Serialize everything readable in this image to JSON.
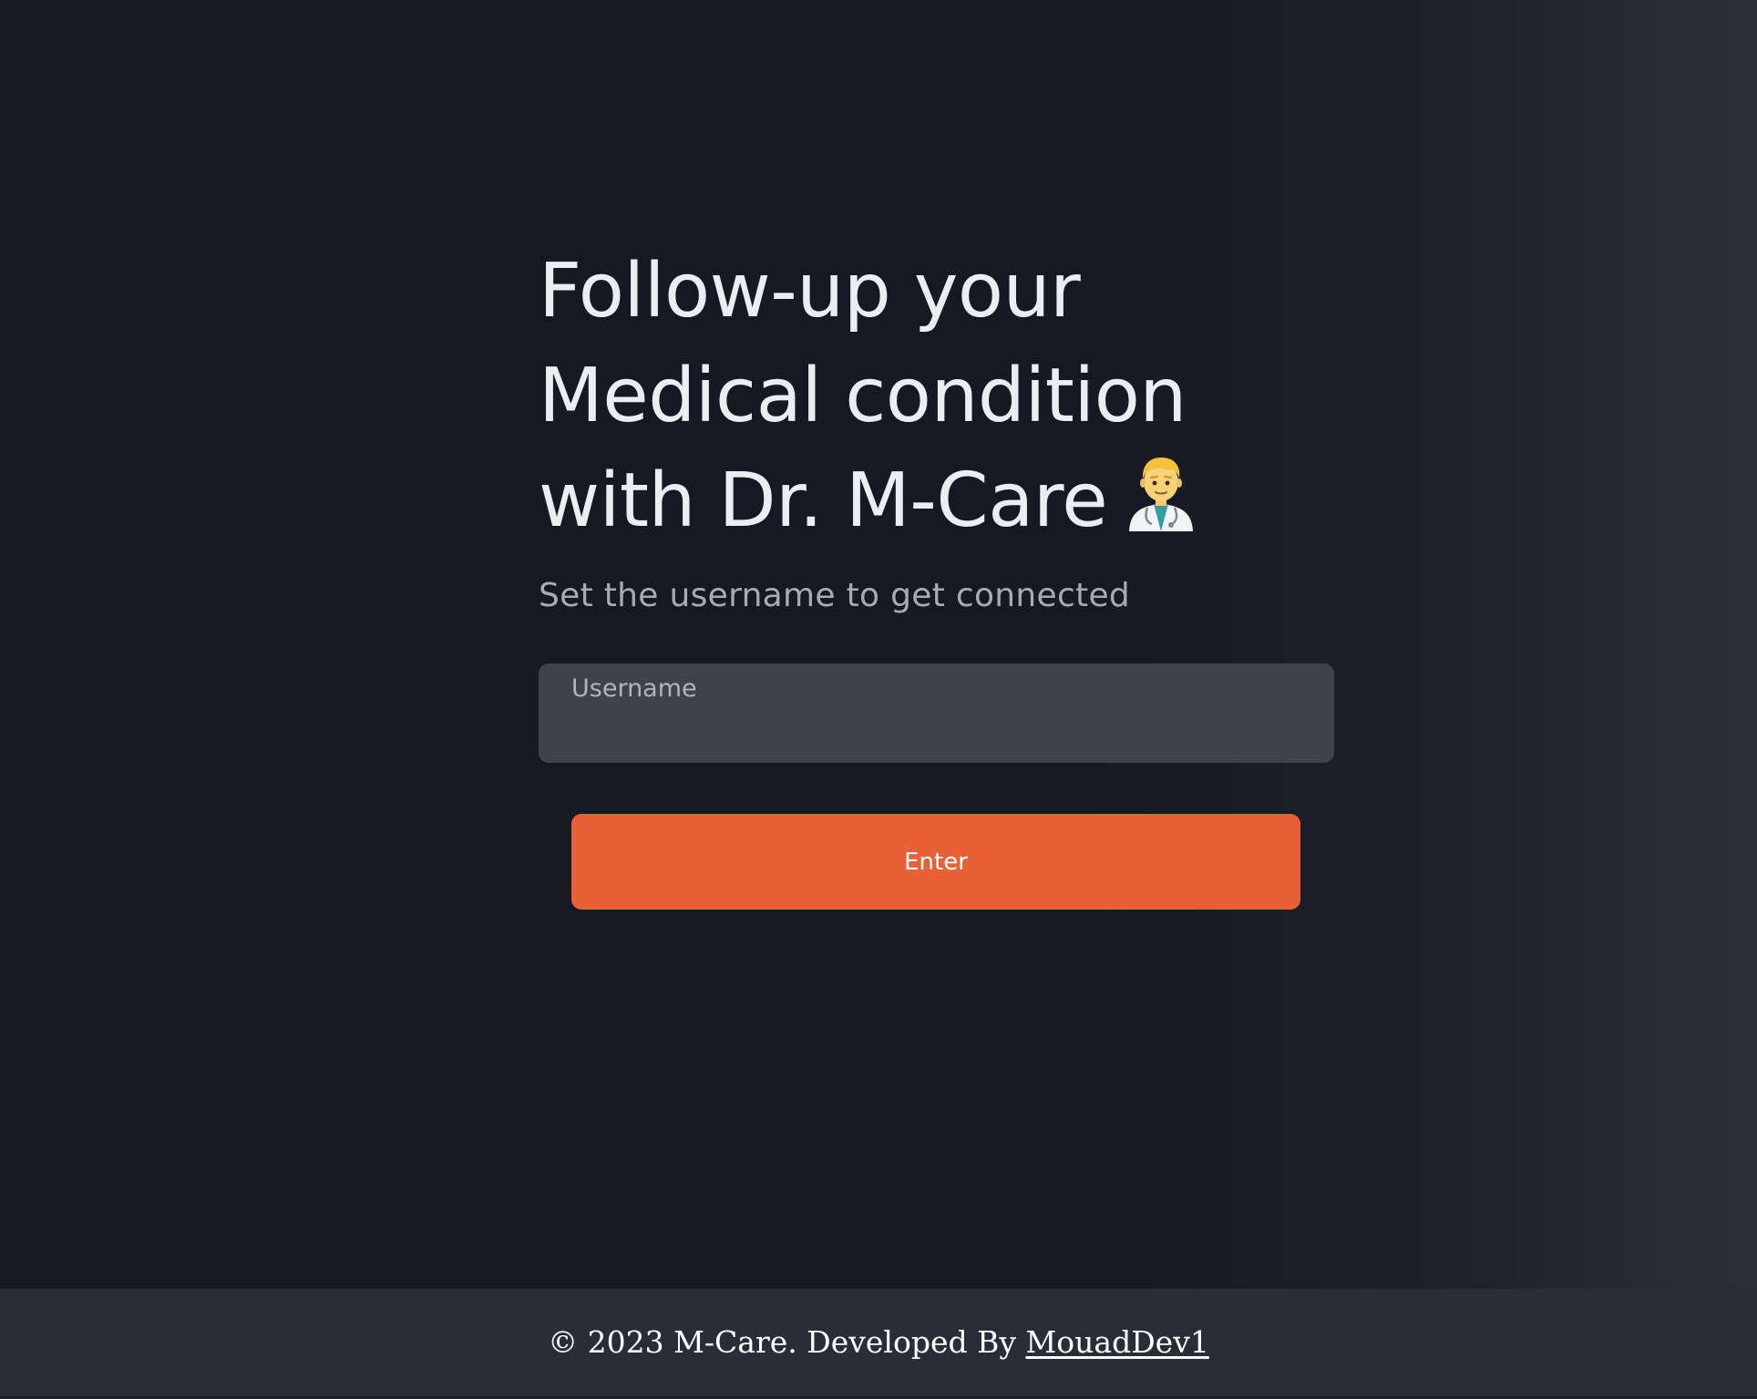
{
  "hero": {
    "headline_line1": "Follow-up your",
    "headline_line2": "Medical condition",
    "headline_line3": "with Dr. M-Care",
    "headline_emoji": "man-health-worker-icon",
    "subtitle": "Set the username to get connected"
  },
  "form": {
    "username_label": "Username",
    "username_value": "",
    "enter_label": "Enter"
  },
  "footer": {
    "copyright": "© 2023 M-Care. Developed By",
    "author_link": "MouadDev1"
  },
  "colors": {
    "background": "#161923",
    "field_background": "#3f424b",
    "accent": "#e86035",
    "footer_background": "#2a2d38"
  }
}
